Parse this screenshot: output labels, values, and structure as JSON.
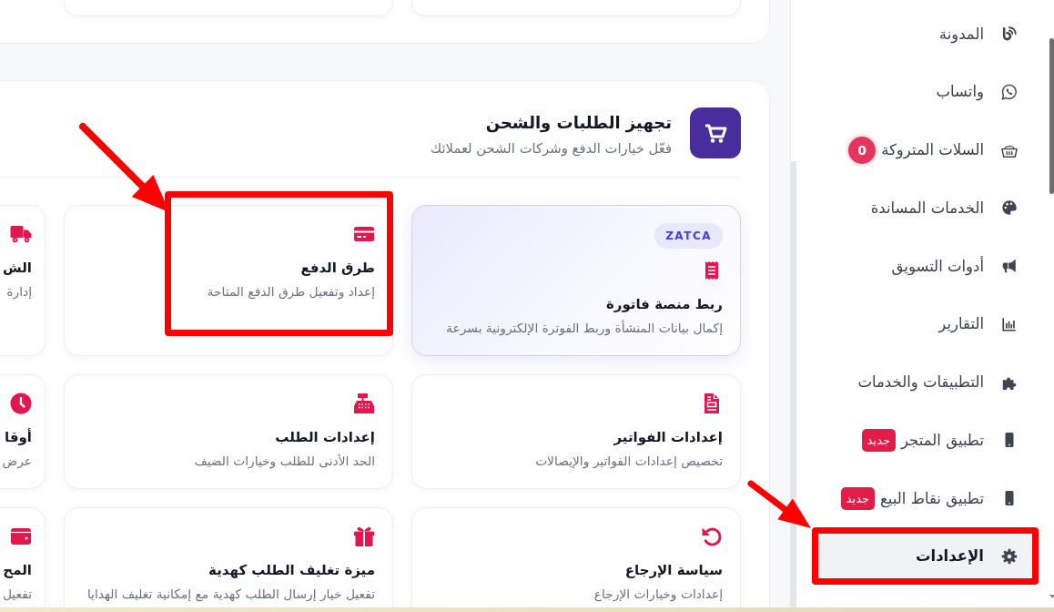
{
  "section": {
    "title": "تجهيز الطلبات والشحن",
    "subtitle": "فعّل خيارات الدفع وشركات الشحن لعملائك",
    "cards": [
      {
        "title": "ربط منصة فاتورة",
        "description": "إكمال بيانات المنشأة وربط الفوترة الإلكترونية بسرعة",
        "badge": "ZATCA",
        "featured": true,
        "highlighted": false
      },
      {
        "title": "طرق الدفع",
        "description": "إعداد وتفعيل طرق الدفع المتاحة",
        "featured": false,
        "highlighted": true
      },
      {
        "title": "الش",
        "description": "إدارة",
        "featured": false,
        "highlighted": false
      },
      {
        "title": "إعدادات الفواتير",
        "description": "تخصيص إعدادات الفواتير والإيصالات",
        "featured": false,
        "highlighted": false
      },
      {
        "title": "إعدادات الطلب",
        "description": "الحد الأدنى للطلب وخيارات الضيف",
        "featured": false,
        "highlighted": false
      },
      {
        "title": "أوقا",
        "description": "عرض",
        "featured": false,
        "highlighted": false
      },
      {
        "title": "سياسة الإرجاع",
        "description": "إعدادات وخيارات الإرجاع",
        "featured": false,
        "highlighted": false
      },
      {
        "title": "ميزة تغليف الطلب كهدية",
        "description": "تفعيل خيار إرسال الطلب كهدية مع إمكانية تغليف الهدايا",
        "featured": false,
        "highlighted": false
      },
      {
        "title": "المح",
        "description": "تفعيل",
        "featured": false,
        "highlighted": false
      }
    ]
  },
  "sidebar": {
    "items": [
      {
        "label": "المدونة",
        "selected": false,
        "highlighted": false
      },
      {
        "label": "واتساب",
        "selected": false,
        "highlighted": false
      },
      {
        "label": "السلات المتروكة",
        "badge": {
          "kind": "count",
          "text": "0"
        },
        "selected": false,
        "highlighted": false
      },
      {
        "label": "الخدمات المساندة",
        "selected": false,
        "highlighted": false
      },
      {
        "label": "أدوات التسويق",
        "selected": false,
        "highlighted": false
      },
      {
        "label": "التقارير",
        "selected": false,
        "highlighted": false
      },
      {
        "label": "التطبيقات والخدمات",
        "selected": false,
        "highlighted": false
      },
      {
        "label": "تطبيق المتجر",
        "badge": {
          "kind": "tag",
          "text": "جديد"
        },
        "selected": false,
        "highlighted": false
      },
      {
        "label": "تطبيق نقاط البيع",
        "badge": {
          "kind": "tag",
          "text": "جديد"
        },
        "selected": false,
        "highlighted": false
      },
      {
        "label": "الإعدادات",
        "selected": true,
        "highlighted": true
      }
    ]
  }
}
